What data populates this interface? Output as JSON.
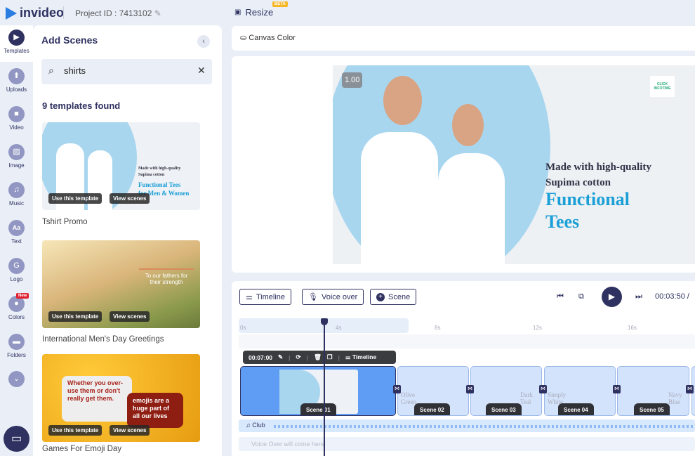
{
  "header": {
    "brand": "invideo",
    "project_id": "Project ID : 7413102",
    "resize_label": "Resize",
    "beta_badge": "BETA"
  },
  "sidebar": {
    "items": [
      {
        "label": "Templates",
        "icon": "templates-icon",
        "active": true
      },
      {
        "label": "Uploads",
        "icon": "upload-icon"
      },
      {
        "label": "Video",
        "icon": "video-icon"
      },
      {
        "label": "Image",
        "icon": "image-icon"
      },
      {
        "label": "Music",
        "icon": "music-icon"
      },
      {
        "label": "Text",
        "icon": "text-icon",
        "glyph": "Aa"
      },
      {
        "label": "Logo",
        "icon": "logo-icon"
      },
      {
        "label": "Colors",
        "icon": "palette-icon"
      },
      {
        "label": "Folders",
        "icon": "folder-icon"
      }
    ],
    "new_badge": "New"
  },
  "panel": {
    "title": "Add Scenes",
    "search_value": "shirts",
    "results": "9 templates found",
    "use_label": "Use this template",
    "view_label": "View scenes",
    "templates": [
      {
        "name": "Tshirt Promo",
        "line1": "Made with high-quality",
        "line2": "Supima cotton",
        "line3": "Functional Tees",
        "line4": "for Men & Women"
      },
      {
        "name": "International Men's Day Greetings",
        "text": "To our fathers for their strength"
      },
      {
        "name": "Games For Emoji Day",
        "bubble1": "Whether you over-use them or don't really get them.",
        "bubble2": "emojis are a huge part of all our lives"
      }
    ]
  },
  "canvas": {
    "canvas_color_label": "Canvas Color",
    "zoom": "1.00",
    "brand_logo": "CLICK INFOTIME",
    "line1": "Made with high-quality",
    "line2": "Supima cotton",
    "title1": "Functional",
    "title2": "Tees",
    "accent": "#1a9fd6"
  },
  "timeline": {
    "buttons": {
      "timeline": "Timeline",
      "voice_over": "Voice over",
      "scene": "Scene"
    },
    "time": "00:03:50 /",
    "ticks": [
      "0s",
      "4s",
      "8s",
      "12s",
      "16s"
    ],
    "scene_toolbar": {
      "duration": "00:07:00",
      "timeline": "Timeline"
    },
    "scenes": [
      {
        "label": "Scene 01"
      },
      {
        "label": "Scene 02",
        "text": "Olive Green"
      },
      {
        "label": "Scene 03",
        "text": "Dark Teal"
      },
      {
        "label": "Scene 04",
        "text": "Simply White"
      },
      {
        "label": "Scene 05",
        "text": "Navy Blue"
      }
    ],
    "audio_track": "Club",
    "voice_over_placeholder": "Voice Over will come here"
  }
}
